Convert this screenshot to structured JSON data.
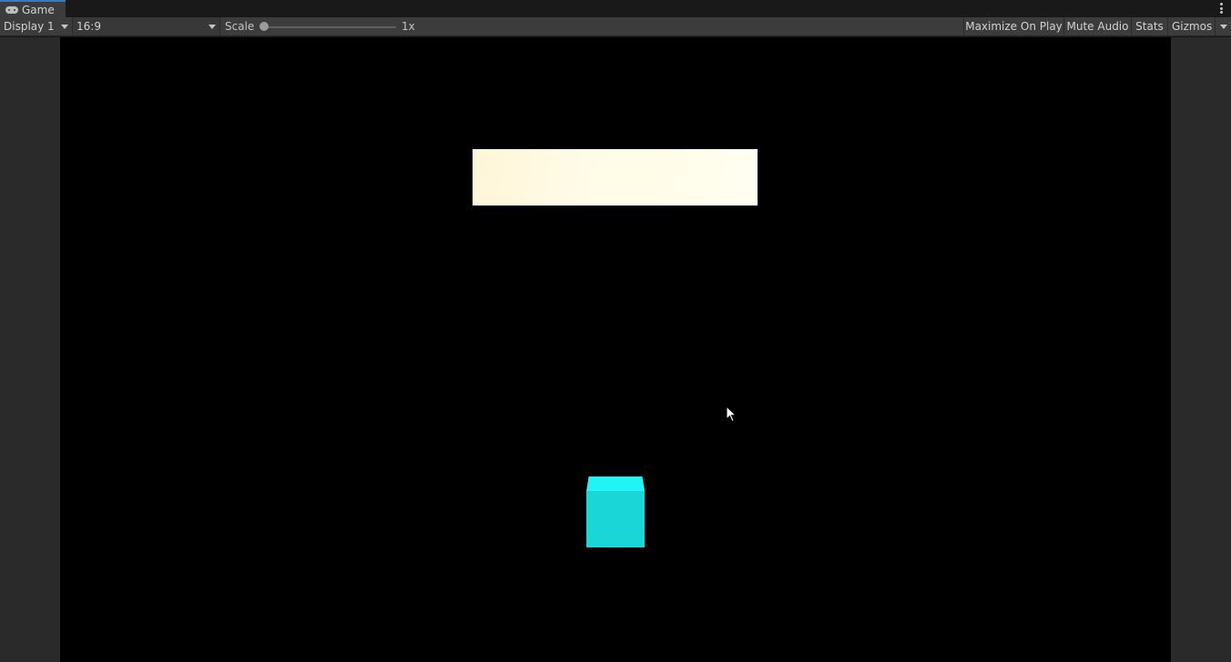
{
  "window": {
    "tab_label": "Game",
    "tab_icon": "gamepad-icon"
  },
  "toolbar": {
    "display": "Display 1",
    "aspect": "16:9",
    "scale_label": "Scale",
    "scale_value": "1x",
    "scale_level": 0,
    "maximize_label": "Maximize On Play",
    "mute_label": "Mute Audio",
    "stats_label": "Stats",
    "gizmos_label": "Gizmos"
  },
  "scene": {
    "background": "#000000",
    "brick_color": "#fffbe6",
    "paddle_color": "#1bd6d6"
  }
}
